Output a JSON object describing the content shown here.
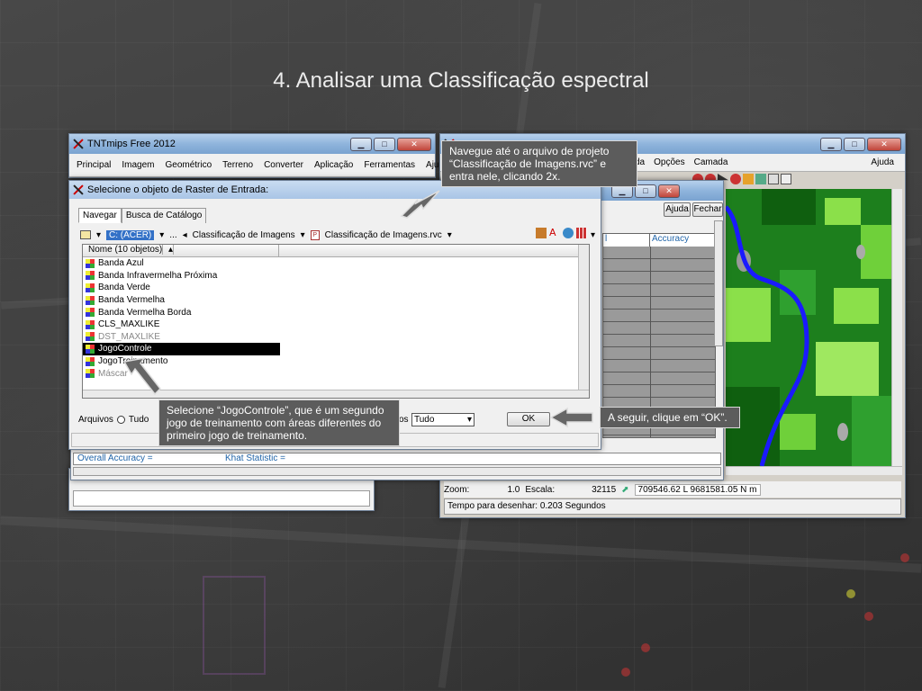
{
  "slide": {
    "title": "4. Analisar uma Classificação espectral"
  },
  "tnt_window": {
    "title": "TNTmips Free 2012",
    "menu": [
      "Principal",
      "Imagem",
      "Geométrico",
      "Terreno",
      "Converter",
      "Aplicação",
      "Ferramentas",
      "Ajuda"
    ]
  },
  "view_window": {
    "menu": [
      "da",
      "Opções",
      "Camada"
    ],
    "help": "Ajuda",
    "zoom_label": "Zoom:",
    "zoom_value": "1.0",
    "scale_label": "Escala:",
    "scale_value": "32115",
    "coords": "709546.62 L  9681581.05 N m",
    "status": "Tempo para desenhar: 0.203 Segundos"
  },
  "accuracy_window": {
    "help_btn": "Ajuda",
    "close_btn": "Fechar",
    "col_left": "l",
    "col_accuracy": "Accuracy",
    "overall": "Overall Accuracy =",
    "khat": "Khat Statistic ="
  },
  "dialog": {
    "title": "Selecione o objeto de Raster de Entrada:",
    "tabs": [
      "Navegar",
      "Busca de Catálogo"
    ],
    "path": {
      "drive": "C: (ACER)",
      "ellipsis": "...",
      "folder": "Classificação de Imagens",
      "project": "Classificação de Imagens.rvc"
    },
    "list_header": "Nome  (10 objetos)",
    "items": [
      {
        "label": "Banda Azul",
        "state": "normal"
      },
      {
        "label": "Banda Infravermelha Próxima",
        "state": "normal"
      },
      {
        "label": "Banda Verde",
        "state": "normal"
      },
      {
        "label": "Banda Vermelha",
        "state": "normal"
      },
      {
        "label": "Banda Vermelha Borda",
        "state": "normal"
      },
      {
        "label": "CLS_MAXLIKE",
        "state": "normal"
      },
      {
        "label": "DST_MAXLIKE",
        "state": "dim"
      },
      {
        "label": "JogoControle",
        "state": "selected"
      },
      {
        "label": "JogoTreinamento",
        "state": "normal"
      },
      {
        "label": "Máscar",
        "state": "dim"
      }
    ],
    "files_label": "Arquivos",
    "files_option": "Tudo",
    "objects_suffix": "os",
    "objects_select": "Tudo",
    "ok": "OK"
  },
  "callouts": {
    "navigate": "Navegue até o arquivo de projeto “Classificação de Imagens.rvc” e entra nele, clicando 2x.",
    "select": "Selecione “JogoControle”, que é um segundo jogo de treinamento com áreas diferentes do primeiro jogo de treinamento.",
    "ok": "A seguir, clique em “OK”."
  },
  "colors": {
    "callout_bg": "#5c5c5c",
    "selection": "#000000",
    "accent_blue": "#3371c7",
    "map_forest": "#228b22",
    "map_field": "#8be04a",
    "map_river": "#1a1aff"
  }
}
